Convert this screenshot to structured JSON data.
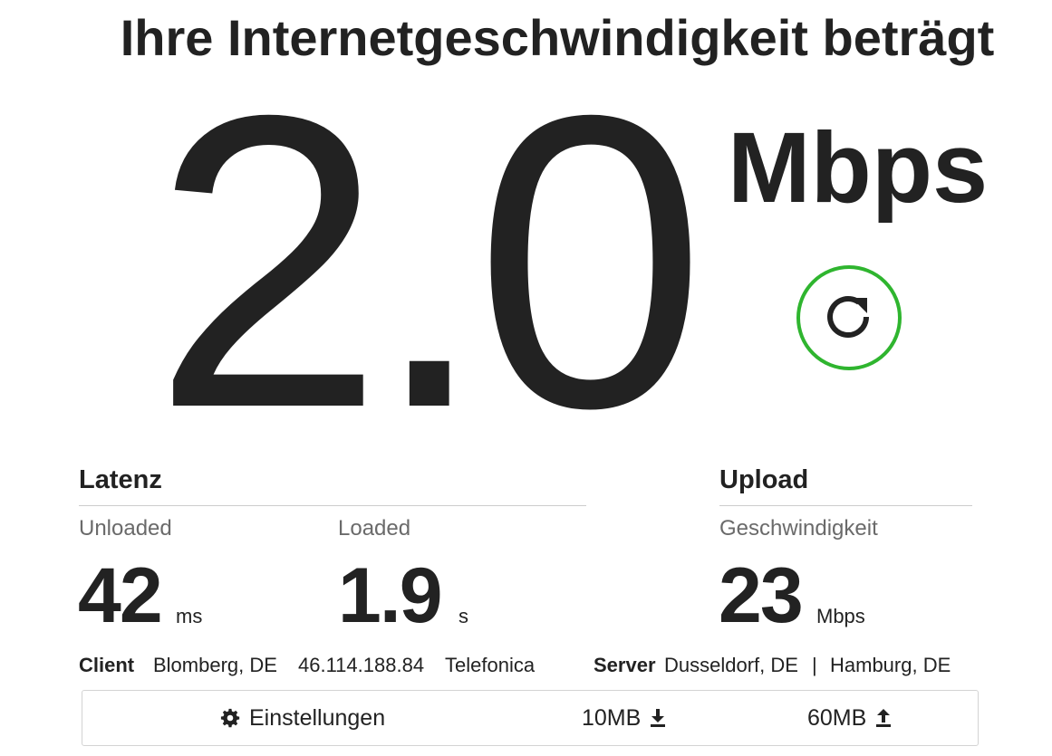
{
  "header": {
    "title": "Ihre Internetgeschwindigkeit beträgt"
  },
  "speed": {
    "value": "2.0",
    "unit": "Mbps",
    "restart_icon": "refresh-icon",
    "ring_color": "#2fb52f"
  },
  "latency": {
    "heading": "Latenz",
    "unloaded": {
      "label": "Unloaded",
      "value": "42",
      "unit": "ms"
    },
    "loaded": {
      "label": "Loaded",
      "value": "1.9",
      "unit": "s"
    }
  },
  "upload": {
    "heading": "Upload",
    "label": "Geschwindigkeit",
    "value": "23",
    "unit": "Mbps"
  },
  "client": {
    "label": "Client",
    "location": "Blomberg, DE",
    "ip": "46.114.188.84",
    "isp": "Telefonica"
  },
  "server": {
    "label": "Server",
    "location_1": "Dusseldorf, DE",
    "separator": "|",
    "location_2": "Hamburg, DE"
  },
  "settings_bar": {
    "settings_label": "Einstellungen",
    "settings_icon": "gear-icon",
    "download_size": "10MB",
    "download_icon": "download-icon",
    "upload_size": "60MB",
    "upload_icon": "upload-icon"
  }
}
